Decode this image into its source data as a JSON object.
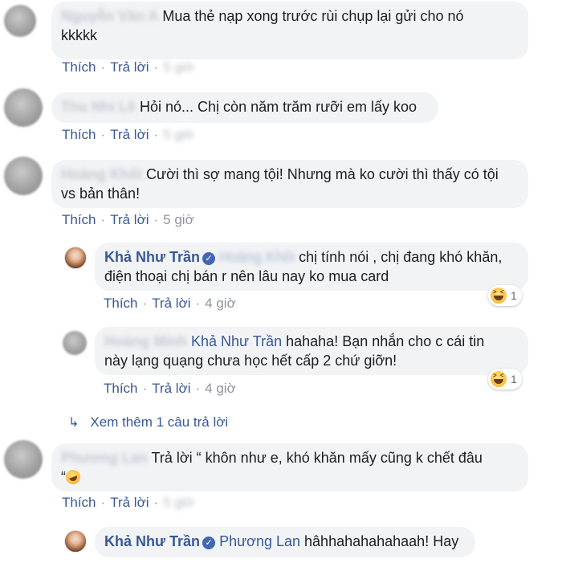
{
  "actions": {
    "like": "Thích",
    "reply": "Trả lời",
    "separator": "·"
  },
  "comments": [
    {
      "author_blurred": "Nguyễn Văn A",
      "text_line1": "Mua thẻ nạp xong trước rùi chụp lại gửi cho nó",
      "text_line2": "kkkkk",
      "time_blurred": "5 giờ"
    },
    {
      "author_blurred": "Thu Nhi Lê",
      "text_line1": "Hỏi nó... Chị còn năm trăm rưỡi em lấy koo",
      "time_blurred": "5 giờ"
    },
    {
      "author_blurred": "Hoàng Khôi",
      "text_line1": "Cười thì sợ mang tội! Nhưng mà ko cười thì thấy có tội",
      "text_line2": "vs bản thân!",
      "time": "5 giờ"
    },
    {
      "author": "Khả Như Trần",
      "mention_blurred": "Hoàng Khôi",
      "text_line1": "chị tính nói , chị đang khó khăn,",
      "text_line2": "điện thoại chị bán r nên lâu nay ko mua card",
      "time": "4 giờ",
      "reaction_count": "1"
    },
    {
      "author_blurred": "Hoàng Minh",
      "mention": "Khả Như Trần",
      "text_line1": "hahaha! Bạn nhắn cho c cái tin",
      "text_line2": "này lạng quạng chưa học hết cấp 2 chứ giỡn!",
      "time": "4 giờ",
      "reaction_count": "1"
    },
    {
      "author_blurred": "Phương Lan",
      "text_line1": "Trả lời “ khôn như e, khó khăn mấy cũng k chết đâu",
      "text_line2": "“",
      "time_blurred": "5 giờ"
    },
    {
      "author": "Khả Như Trần",
      "mention": "Phương Lan",
      "text_line1": "hâhhahahahahaah! Hay"
    }
  ],
  "view_more": "Xem thêm 1 câu trả lời",
  "colors": {
    "link": "#385898",
    "bubble": "#f2f3f5",
    "meta": "#90949c",
    "verified": "#4267b2"
  }
}
